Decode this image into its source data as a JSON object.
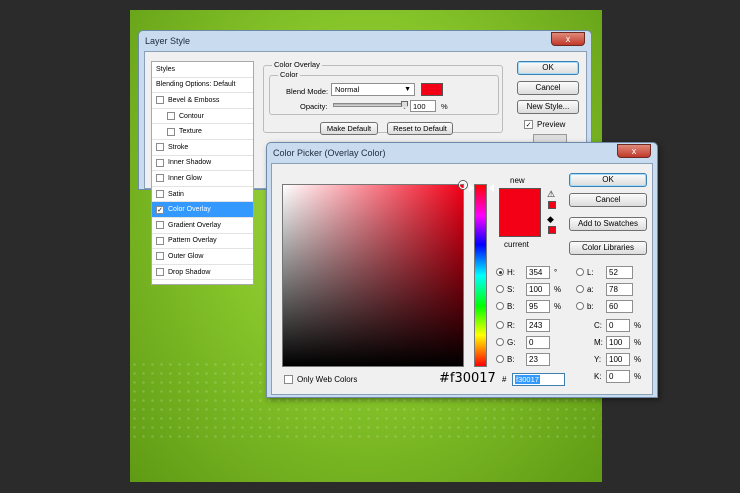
{
  "layer_style": {
    "title": "Layer Style",
    "close": "x",
    "styles": [
      {
        "label": "Styles",
        "check": false,
        "sub": false,
        "selected": false
      },
      {
        "label": "Blending Options: Default",
        "check": false,
        "sub": false,
        "selected": false
      },
      {
        "label": "Bevel & Emboss",
        "check": true,
        "checked": false,
        "sub": false,
        "selected": false
      },
      {
        "label": "Contour",
        "check": true,
        "checked": false,
        "sub": true,
        "selected": false
      },
      {
        "label": "Texture",
        "check": true,
        "checked": false,
        "sub": true,
        "selected": false
      },
      {
        "label": "Stroke",
        "check": true,
        "checked": false,
        "sub": false,
        "selected": false
      },
      {
        "label": "Inner Shadow",
        "check": true,
        "checked": false,
        "sub": false,
        "selected": false
      },
      {
        "label": "Inner Glow",
        "check": true,
        "checked": false,
        "sub": false,
        "selected": false
      },
      {
        "label": "Satin",
        "check": true,
        "checked": false,
        "sub": false,
        "selected": false
      },
      {
        "label": "Color Overlay",
        "check": true,
        "checked": true,
        "sub": false,
        "selected": true
      },
      {
        "label": "Gradient Overlay",
        "check": true,
        "checked": false,
        "sub": false,
        "selected": false
      },
      {
        "label": "Pattern Overlay",
        "check": true,
        "checked": false,
        "sub": false,
        "selected": false
      },
      {
        "label": "Outer Glow",
        "check": true,
        "checked": false,
        "sub": false,
        "selected": false
      },
      {
        "label": "Drop Shadow",
        "check": true,
        "checked": false,
        "sub": false,
        "selected": false
      }
    ],
    "section_title": "Color Overlay",
    "group_title": "Color",
    "blend_mode_label": "Blend Mode:",
    "blend_mode_value": "Normal",
    "opacity_label": "Opacity:",
    "opacity_value": "100",
    "opacity_unit": "%",
    "opacity_fraction": 1.0,
    "make_default": "Make Default",
    "reset_default": "Reset to Default",
    "ok": "OK",
    "cancel": "Cancel",
    "new_style": "New Style...",
    "preview": "Preview",
    "preview_checked": "✓",
    "overlay_color": "#f30017"
  },
  "color_picker": {
    "title": "Color Picker (Overlay Color)",
    "close": "x",
    "new_label": "new",
    "current_label": "current",
    "new_color": "#f30017",
    "current_color": "#f30017",
    "ok": "OK",
    "cancel": "Cancel",
    "add_swatches": "Add to Swatches",
    "color_libraries": "Color Libraries",
    "only_web": "Only Web Colors",
    "hex_display": "#f30017",
    "hex_label": "#",
    "hex_value": "f30017",
    "hsb": [
      {
        "label": "H:",
        "value": "354",
        "unit": "°",
        "on": true
      },
      {
        "label": "S:",
        "value": "100",
        "unit": "%",
        "on": false
      },
      {
        "label": "B:",
        "value": "95",
        "unit": "%",
        "on": false
      }
    ],
    "rgb": [
      {
        "label": "R:",
        "value": "243"
      },
      {
        "label": "G:",
        "value": "0"
      },
      {
        "label": "B:",
        "value": "23"
      }
    ],
    "lab": [
      {
        "label": "L:",
        "value": "52"
      },
      {
        "label": "a:",
        "value": "78"
      },
      {
        "label": "b:",
        "value": "60"
      }
    ],
    "cmyk": [
      {
        "label": "C:",
        "value": "0",
        "unit": "%"
      },
      {
        "label": "M:",
        "value": "100",
        "unit": "%"
      },
      {
        "label": "Y:",
        "value": "100",
        "unit": "%"
      },
      {
        "label": "K:",
        "value": "0",
        "unit": "%"
      }
    ]
  }
}
